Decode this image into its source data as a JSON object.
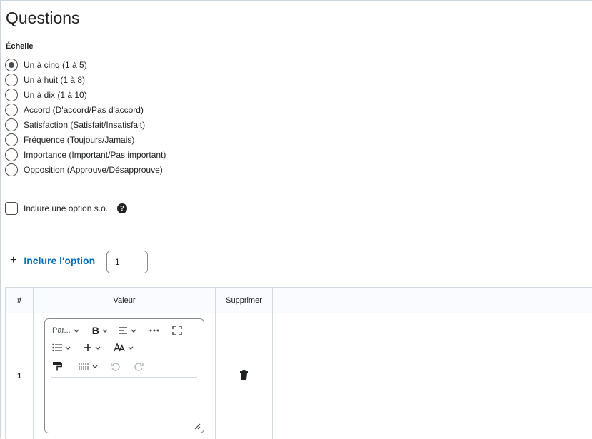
{
  "page": {
    "title": "Questions"
  },
  "scale": {
    "label": "Échelle",
    "options": [
      {
        "label": "Un à cinq (1 à 5)",
        "selected": true
      },
      {
        "label": "Un à huit (1 à 8)",
        "selected": false
      },
      {
        "label": "Un à dix (1 à 10)",
        "selected": false
      },
      {
        "label": "Accord (D'accord/Pas d'accord)",
        "selected": false
      },
      {
        "label": "Satisfaction (Satisfait/Insatisfait)",
        "selected": false
      },
      {
        "label": "Fréquence (Toujours/Jamais)",
        "selected": false
      },
      {
        "label": "Importance (Important/Pas important)",
        "selected": false
      },
      {
        "label": "Opposition (Approuve/Désapprouve)",
        "selected": false
      }
    ]
  },
  "na_option": {
    "label": "Inclure une option s.o.",
    "checked": false,
    "help_icon": "question-circle-icon"
  },
  "add_option": {
    "label": "Inclure l'option",
    "count_value": "1"
  },
  "table": {
    "headers": {
      "num": "#",
      "value": "Valeur",
      "delete": "Supprimer"
    },
    "rows": [
      {
        "num": "1"
      }
    ]
  },
  "editor": {
    "paragraph_label": "Par...",
    "bold_label": "B",
    "icons": [
      "bold-icon",
      "align-icon",
      "more-icon",
      "fullscreen-icon",
      "list-icon",
      "insert-icon",
      "font-size-icon",
      "format-painter-icon",
      "line-spacing-icon",
      "undo-icon",
      "redo-icon"
    ]
  },
  "colors": {
    "link": "#006fbf",
    "text": "#202122",
    "border": "#d3d9e3"
  }
}
